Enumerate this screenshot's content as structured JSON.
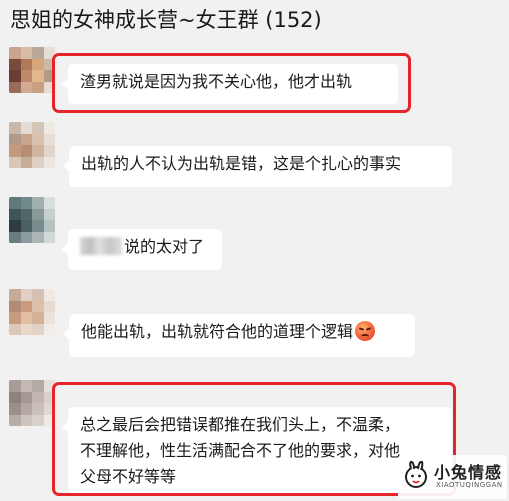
{
  "header": {
    "title": "思姐的女神成长营~女王群 (152)"
  },
  "messages": [
    {
      "text": "渣男就说是因为我不关心他，他才出轨",
      "highlighted": true
    },
    {
      "text": "出轨的人不认为出轨是错，这是个扎心的事实",
      "highlighted": false
    },
    {
      "text": "说的太对了",
      "highlighted": false,
      "mention_redacted": true
    },
    {
      "text": "他能出轨，出轨就符合他的道理个逻辑",
      "highlighted": false,
      "emoji": "disappointed-face-icon"
    },
    {
      "lines": [
        "总之最后会把错误都推在我们头上，不温柔，",
        "不理解他，性生活满配合不了他的要求，对他",
        "父母不好等等"
      ],
      "highlighted": true
    }
  ],
  "watermark": {
    "name": "小兔情感",
    "sub": "XIAOTUQINGGAN"
  },
  "colors": {
    "background": "#f1f1f1",
    "bubble": "#ffffff",
    "highlight": "#e8242b"
  }
}
